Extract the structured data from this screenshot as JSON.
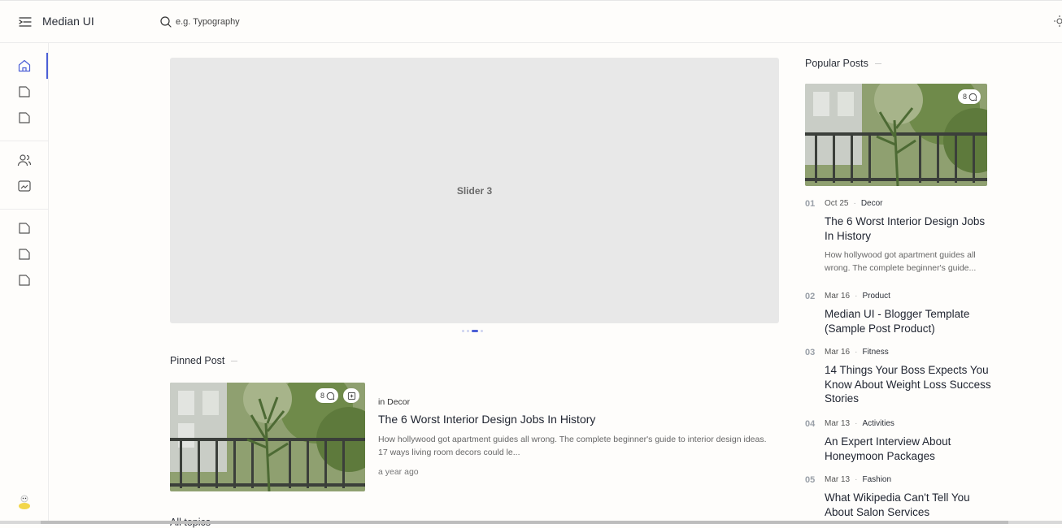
{
  "header": {
    "brand": "Median UI",
    "search_placeholder": "e.g. Typography"
  },
  "sidebar": {
    "items": [
      {
        "icon": "home-icon"
      },
      {
        "icon": "file-icon"
      },
      {
        "icon": "file-icon"
      },
      {
        "icon": "users-icon"
      },
      {
        "icon": "image-edit-icon"
      },
      {
        "icon": "file-icon"
      },
      {
        "icon": "file-icon"
      },
      {
        "icon": "file-icon"
      }
    ]
  },
  "slider": {
    "label": "Slider 3",
    "slide_count": 4,
    "active_index": 2
  },
  "pinned": {
    "section_title": "Pinned Post",
    "comment_count": "8",
    "category_prefix": "in",
    "category": "Decor",
    "title": "The 6 Worst Interior Design Jobs In History",
    "snippet": "How hollywood got apartment guides all wrong. The complete beginner's guide to interior design ideas. 17 ways living room decors could le...",
    "time": "a year ago"
  },
  "all_topics": {
    "title": "All topics"
  },
  "popular": {
    "section_title": "Popular Posts",
    "comment_count": "8",
    "items": [
      {
        "num": "01",
        "date": "Oct 25",
        "category": "Decor",
        "title": "The 6 Worst Interior Design Jobs In History",
        "snippet": "How hollywood got apartment guides all wrong. The complete beginner's guide..."
      },
      {
        "num": "02",
        "date": "Mar 16",
        "category": "Product",
        "title": "Median UI - Blogger Template (Sample Post Product)"
      },
      {
        "num": "03",
        "date": "Mar 16",
        "category": "Fitness",
        "title": "14 Things Your Boss Expects You Know About Weight Loss Success Stories"
      },
      {
        "num": "04",
        "date": "Mar 13",
        "category": "Activities",
        "title": "An Expert Interview About Honeymoon Packages"
      },
      {
        "num": "05",
        "date": "Mar 13",
        "category": "Fashion",
        "title": "What Wikipedia Can't Tell You About Salon Services"
      }
    ]
  },
  "colors": {
    "accent": "#4b5fd6",
    "slider_bg": "#e8e8e8",
    "background": "#fefdfb"
  }
}
